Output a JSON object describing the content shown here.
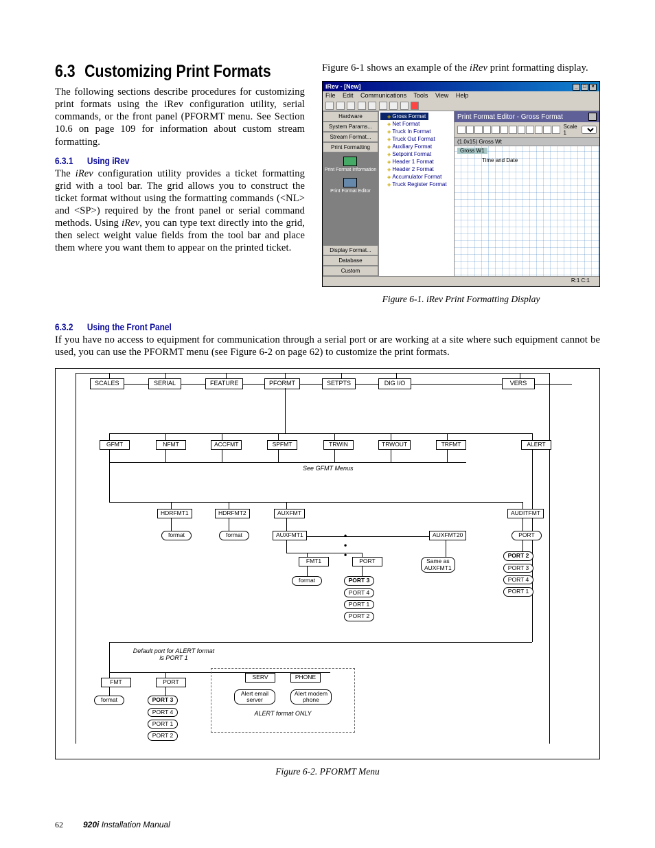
{
  "section": {
    "number": "6.3",
    "title": "Customizing Print Formats",
    "intro": "The following sections describe procedures for customizing print formats using the iRev configuration utility, serial commands, or the front panel (PFORMT menu. See Section 10.6 on page 109 for information about custom stream formatting."
  },
  "sub631": {
    "num": "6.3.1",
    "title": "Using iRev",
    "body_pre": "The ",
    "body_irev": "iRev",
    "body_mid": " configuration utility provides a ticket formatting grid with a tool bar. The grid allows you to construct the ticket format without using the formatting commands (<NL> and <SP>) required by the front panel or serial command methods. Using ",
    "body_irev2": "iRev",
    "body_post": ", you can type text directly into the grid, then select weight value fields from the tool bar and place them where you want them to appear on the printed ticket."
  },
  "right_intro": "Figure 6-1 shows an example of the iRev print formatting display.",
  "right_intro_pre": "Figure 6-1 shows an example of the ",
  "right_intro_irev": "iRev",
  "right_intro_post": " print formatting display.",
  "app": {
    "title": "iRev - [New]",
    "menus": [
      "File",
      "Edit",
      "Communications",
      "Tools",
      "View",
      "Help"
    ],
    "sidebar_top": [
      "Hardware",
      "System Params...",
      "Stream Format...",
      "Print Formatting"
    ],
    "sidebar_mid_label1": "Print Format Information",
    "sidebar_mid_label2": "Print Format Editor",
    "sidebar_bot": [
      "Display Format...",
      "Database",
      "Custom"
    ],
    "tree": [
      "Gross Format",
      "Net Format",
      "Truck In Format",
      "Truck Out Format",
      "Auxiliary Format",
      "Setpoint Format",
      "Header 1 Format",
      "Header 2 Format",
      "Accumulator Format",
      "Truck Register Format"
    ],
    "editor_title": "Print Format Editor - Gross Format",
    "scale_label": "Scale 1",
    "grid_header": "(1.0x15)      Gross Wt",
    "grid_row1": "Gross W1",
    "grid_row2": "Time and Date",
    "status": "R:1  C:1"
  },
  "caption1": "Figure 6-1. iRev Print Formatting Display",
  "sub632": {
    "num": "6.3.2",
    "title": "Using the Front Panel",
    "body": "If you have no access to equipment for communication through a serial port or are working at a site where such equipment cannot be used, you can use the PFORMT menu (see Figure 6-2 on page 62) to customize the print formats."
  },
  "flow": {
    "row1": [
      "SCALES",
      "SERIAL",
      "FEATURE",
      "PFORMT",
      "SETPTS",
      "DIG I/O",
      "VERS"
    ],
    "row2": [
      "GFMT",
      "NFMT",
      "ACCFMT",
      "SPFMT",
      "TRWIN",
      "TRWOUT",
      "TRFMT",
      "ALERT"
    ],
    "row2_note": "See GFMT Menus",
    "row3": [
      "HDRFMT1",
      "HDRFMT2",
      "AUXFMT",
      "AUDITFMT"
    ],
    "row3_fmt": "format",
    "aux_labels": {
      "auxfmt1": "AUXFMT1",
      "auxfmt20": "AUXFMT20",
      "same": "Same as AUXFMT1",
      "fmt1": "FMT1",
      "port": "PORT",
      "format": "format"
    },
    "port_stack_right": [
      "PORT 2",
      "PORT 3",
      "PORT 4",
      "PORT 1"
    ],
    "port_stack_center": [
      "PORT 3",
      "PORT 4",
      "PORT 1",
      "PORT 2"
    ],
    "alert_note1": "Default port for ALERT format is PORT 1",
    "alert_row": [
      "FMT",
      "PORT",
      "SERV",
      "PHONE"
    ],
    "alert_sub": {
      "format": "format",
      "port3": "PORT 3",
      "port4": "PORT 4",
      "port1": "PORT 1",
      "port2": "PORT 2",
      "serv": "Alert email server",
      "phone": "Alert modem phone",
      "only": "ALERT format ONLY"
    }
  },
  "caption2": "Figure 6-2. PFORMT Menu",
  "footer": {
    "page": "62",
    "manual_bold": "920i",
    "manual_rest": " Installation Manual"
  }
}
